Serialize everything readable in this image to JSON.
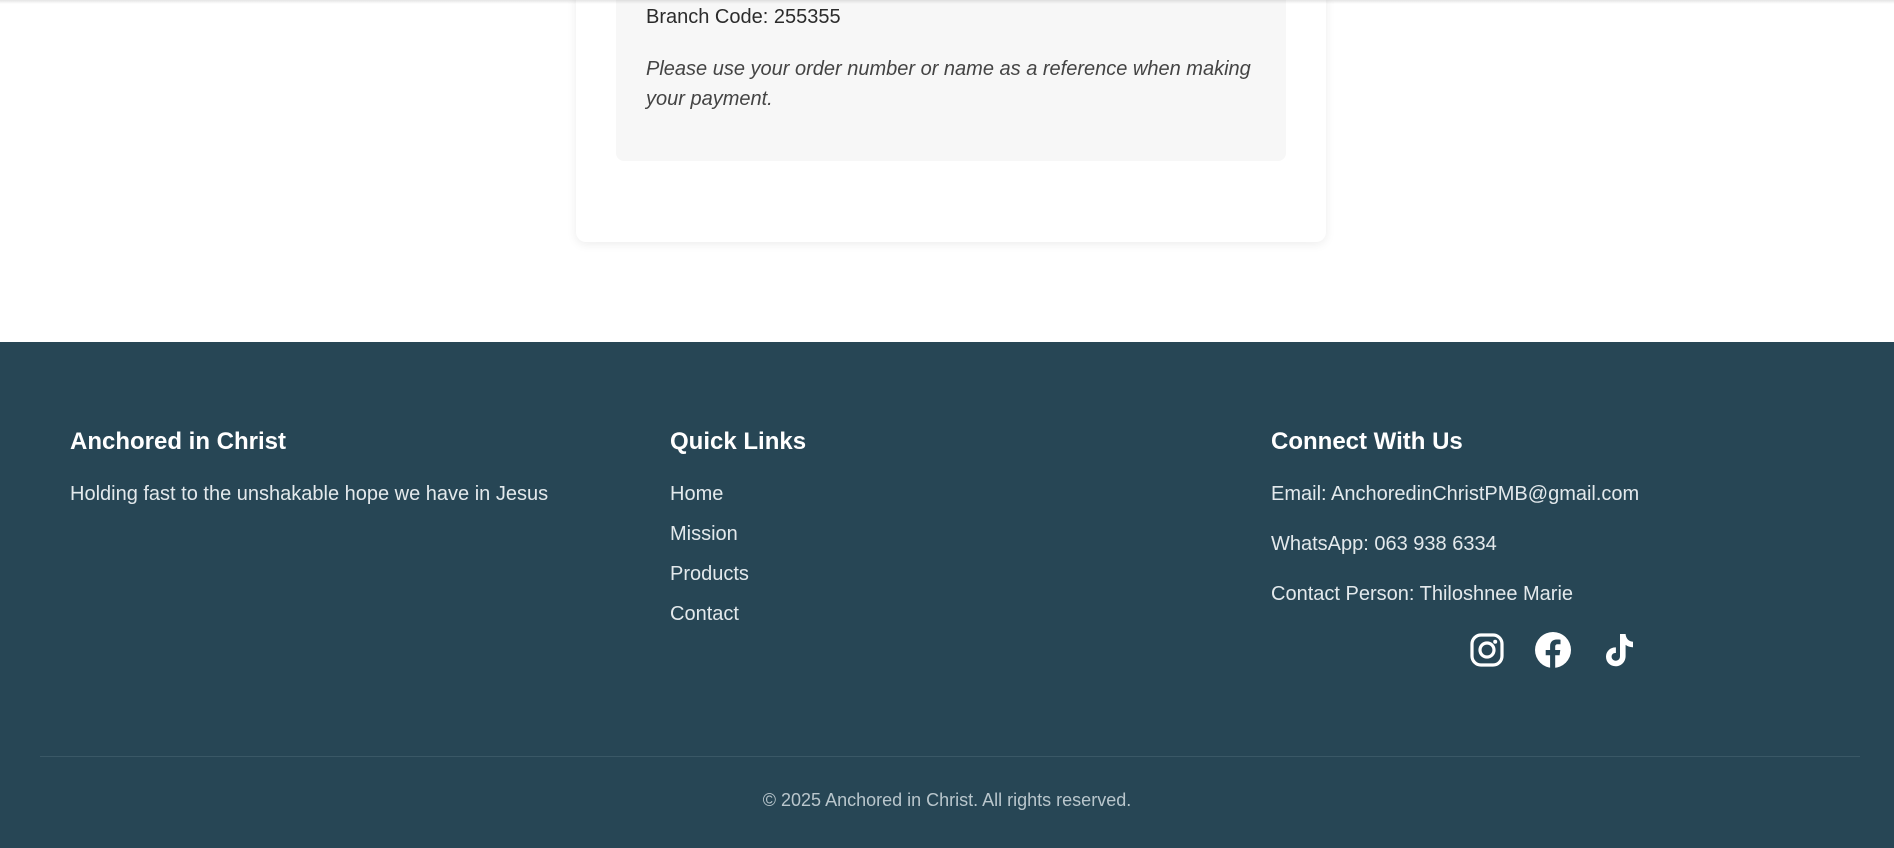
{
  "payment_card": {
    "branch_code": "Branch Code: 255355",
    "reference_note": "Please use your order number or name as a reference when making your payment."
  },
  "footer": {
    "brand": {
      "title": "Anchored in Christ",
      "tagline": "Holding fast to the unshakable hope we have in Jesus"
    },
    "quick_links": {
      "title": "Quick Links",
      "items": [
        "Home",
        "Mission",
        "Products",
        "Contact"
      ]
    },
    "connect": {
      "title": "Connect With Us",
      "email": "Email: AnchoredinChristPMB@gmail.com",
      "whatsapp": "WhatsApp: 063 938 6334",
      "contact_person": "Contact Person: Thiloshnee Marie",
      "social_icons": [
        "instagram-icon",
        "facebook-icon",
        "tiktok-icon"
      ]
    },
    "copyright": "© 2025 Anchored in Christ. All rights reserved."
  },
  "colors": {
    "footer_background": "#274655",
    "footer_text": "#e3e9ec",
    "card_background": "#ffffff",
    "bank_box_background": "#f7f7f7"
  }
}
